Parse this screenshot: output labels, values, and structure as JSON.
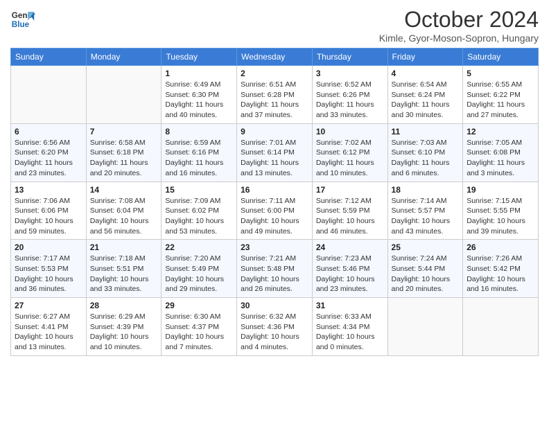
{
  "logo": {
    "line1": "General",
    "line2": "Blue"
  },
  "title": "October 2024",
  "subtitle": "Kimle, Gyor-Moson-Sopron, Hungary",
  "days_of_week": [
    "Sunday",
    "Monday",
    "Tuesday",
    "Wednesday",
    "Thursday",
    "Friday",
    "Saturday"
  ],
  "weeks": [
    [
      {
        "day": "",
        "info": ""
      },
      {
        "day": "",
        "info": ""
      },
      {
        "day": "1",
        "info": "Sunrise: 6:49 AM\nSunset: 6:30 PM\nDaylight: 11 hours and 40 minutes."
      },
      {
        "day": "2",
        "info": "Sunrise: 6:51 AM\nSunset: 6:28 PM\nDaylight: 11 hours and 37 minutes."
      },
      {
        "day": "3",
        "info": "Sunrise: 6:52 AM\nSunset: 6:26 PM\nDaylight: 11 hours and 33 minutes."
      },
      {
        "day": "4",
        "info": "Sunrise: 6:54 AM\nSunset: 6:24 PM\nDaylight: 11 hours and 30 minutes."
      },
      {
        "day": "5",
        "info": "Sunrise: 6:55 AM\nSunset: 6:22 PM\nDaylight: 11 hours and 27 minutes."
      }
    ],
    [
      {
        "day": "6",
        "info": "Sunrise: 6:56 AM\nSunset: 6:20 PM\nDaylight: 11 hours and 23 minutes."
      },
      {
        "day": "7",
        "info": "Sunrise: 6:58 AM\nSunset: 6:18 PM\nDaylight: 11 hours and 20 minutes."
      },
      {
        "day": "8",
        "info": "Sunrise: 6:59 AM\nSunset: 6:16 PM\nDaylight: 11 hours and 16 minutes."
      },
      {
        "day": "9",
        "info": "Sunrise: 7:01 AM\nSunset: 6:14 PM\nDaylight: 11 hours and 13 minutes."
      },
      {
        "day": "10",
        "info": "Sunrise: 7:02 AM\nSunset: 6:12 PM\nDaylight: 11 hours and 10 minutes."
      },
      {
        "day": "11",
        "info": "Sunrise: 7:03 AM\nSunset: 6:10 PM\nDaylight: 11 hours and 6 minutes."
      },
      {
        "day": "12",
        "info": "Sunrise: 7:05 AM\nSunset: 6:08 PM\nDaylight: 11 hours and 3 minutes."
      }
    ],
    [
      {
        "day": "13",
        "info": "Sunrise: 7:06 AM\nSunset: 6:06 PM\nDaylight: 10 hours and 59 minutes."
      },
      {
        "day": "14",
        "info": "Sunrise: 7:08 AM\nSunset: 6:04 PM\nDaylight: 10 hours and 56 minutes."
      },
      {
        "day": "15",
        "info": "Sunrise: 7:09 AM\nSunset: 6:02 PM\nDaylight: 10 hours and 53 minutes."
      },
      {
        "day": "16",
        "info": "Sunrise: 7:11 AM\nSunset: 6:00 PM\nDaylight: 10 hours and 49 minutes."
      },
      {
        "day": "17",
        "info": "Sunrise: 7:12 AM\nSunset: 5:59 PM\nDaylight: 10 hours and 46 minutes."
      },
      {
        "day": "18",
        "info": "Sunrise: 7:14 AM\nSunset: 5:57 PM\nDaylight: 10 hours and 43 minutes."
      },
      {
        "day": "19",
        "info": "Sunrise: 7:15 AM\nSunset: 5:55 PM\nDaylight: 10 hours and 39 minutes."
      }
    ],
    [
      {
        "day": "20",
        "info": "Sunrise: 7:17 AM\nSunset: 5:53 PM\nDaylight: 10 hours and 36 minutes."
      },
      {
        "day": "21",
        "info": "Sunrise: 7:18 AM\nSunset: 5:51 PM\nDaylight: 10 hours and 33 minutes."
      },
      {
        "day": "22",
        "info": "Sunrise: 7:20 AM\nSunset: 5:49 PM\nDaylight: 10 hours and 29 minutes."
      },
      {
        "day": "23",
        "info": "Sunrise: 7:21 AM\nSunset: 5:48 PM\nDaylight: 10 hours and 26 minutes."
      },
      {
        "day": "24",
        "info": "Sunrise: 7:23 AM\nSunset: 5:46 PM\nDaylight: 10 hours and 23 minutes."
      },
      {
        "day": "25",
        "info": "Sunrise: 7:24 AM\nSunset: 5:44 PM\nDaylight: 10 hours and 20 minutes."
      },
      {
        "day": "26",
        "info": "Sunrise: 7:26 AM\nSunset: 5:42 PM\nDaylight: 10 hours and 16 minutes."
      }
    ],
    [
      {
        "day": "27",
        "info": "Sunrise: 6:27 AM\nSunset: 4:41 PM\nDaylight: 10 hours and 13 minutes."
      },
      {
        "day": "28",
        "info": "Sunrise: 6:29 AM\nSunset: 4:39 PM\nDaylight: 10 hours and 10 minutes."
      },
      {
        "day": "29",
        "info": "Sunrise: 6:30 AM\nSunset: 4:37 PM\nDaylight: 10 hours and 7 minutes."
      },
      {
        "day": "30",
        "info": "Sunrise: 6:32 AM\nSunset: 4:36 PM\nDaylight: 10 hours and 4 minutes."
      },
      {
        "day": "31",
        "info": "Sunrise: 6:33 AM\nSunset: 4:34 PM\nDaylight: 10 hours and 0 minutes."
      },
      {
        "day": "",
        "info": ""
      },
      {
        "day": "",
        "info": ""
      }
    ]
  ]
}
